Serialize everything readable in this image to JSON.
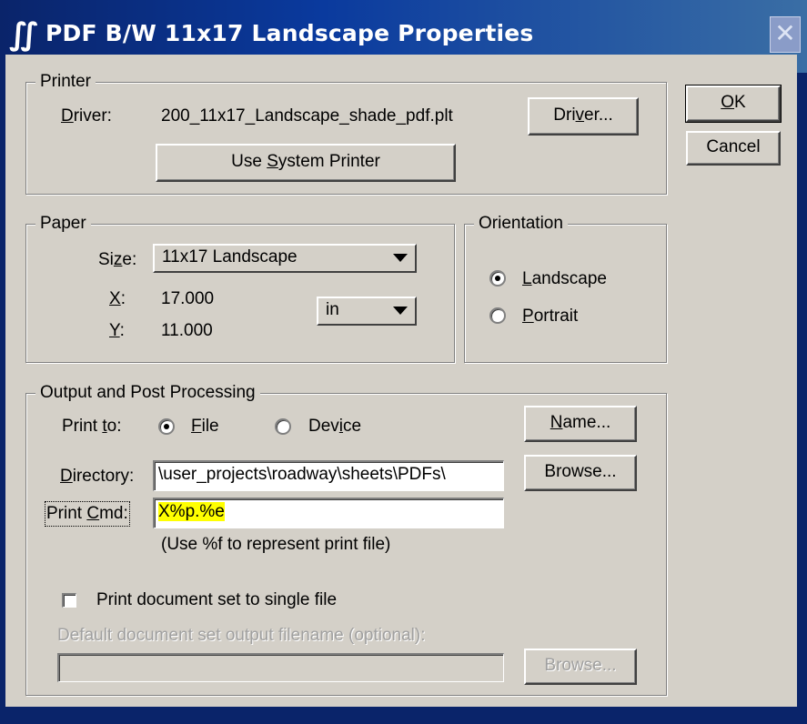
{
  "window": {
    "title": "PDF B/W 11x17 Landscape Properties",
    "close_glyph": "✕"
  },
  "buttons": {
    "ok": {
      "label_prefix": "",
      "label_ul": "O",
      "label_rest": "K"
    },
    "cancel": "Cancel"
  },
  "printer": {
    "group_title": "Printer",
    "driver_label_ul": "D",
    "driver_label_rest": "river:",
    "driver_value": "200_11x17_Landscape_shade_pdf.plt",
    "driver_button_prefix": "Dri",
    "driver_button_ul": "v",
    "driver_button_rest": "er...",
    "system_printer_prefix": "Use ",
    "system_printer_ul": "S",
    "system_printer_rest": "ystem Printer"
  },
  "paper": {
    "group_title": "Paper",
    "size_label_prefix": "Si",
    "size_label_ul": "z",
    "size_label_rest": "e:",
    "size_value": "11x17 Landscape",
    "x_label_ul": "X",
    "x_label_rest": ":",
    "x_value": "17.000",
    "y_label_ul": "Y",
    "y_label_rest": ":",
    "y_value": "11.000",
    "units_value": "in"
  },
  "orientation": {
    "group_title": "Orientation",
    "landscape_ul": "L",
    "landscape_rest": "andscape",
    "portrait_ul": "P",
    "portrait_rest": "ortrait",
    "selected": "Landscape"
  },
  "output": {
    "group_title": "Output and Post Processing",
    "print_to_label_prefix": "Print ",
    "print_to_label_ul": "t",
    "print_to_label_rest": "o:",
    "file_ul": "F",
    "file_rest": "ile",
    "device_prefix": "Dev",
    "device_ul": "i",
    "device_rest": "ce",
    "selected": "File",
    "name_button_ul": "N",
    "name_button_rest": "ame...",
    "directory_label_ul": "D",
    "directory_label_rest": "irectory:",
    "directory_value": "\\user_projects\\roadway\\sheets\\PDFs\\",
    "browse_button": "Browse...",
    "print_cmd_label_prefix": "Print ",
    "print_cmd_label_ul": "C",
    "print_cmd_label_rest": "md:",
    "print_cmd_value": "X%p.%e",
    "hint": "(Use %f to represent print file)",
    "single_file_label": "Print document set to single file",
    "single_file_checked": false,
    "default_filename_label": "Default document set output filename (optional):",
    "default_filename_value": "",
    "default_browse_button": "Browse..."
  },
  "colors": {
    "title_bar": "#0a246a",
    "dialog_face": "#d4d0c8",
    "highlight": "#ffff00"
  }
}
